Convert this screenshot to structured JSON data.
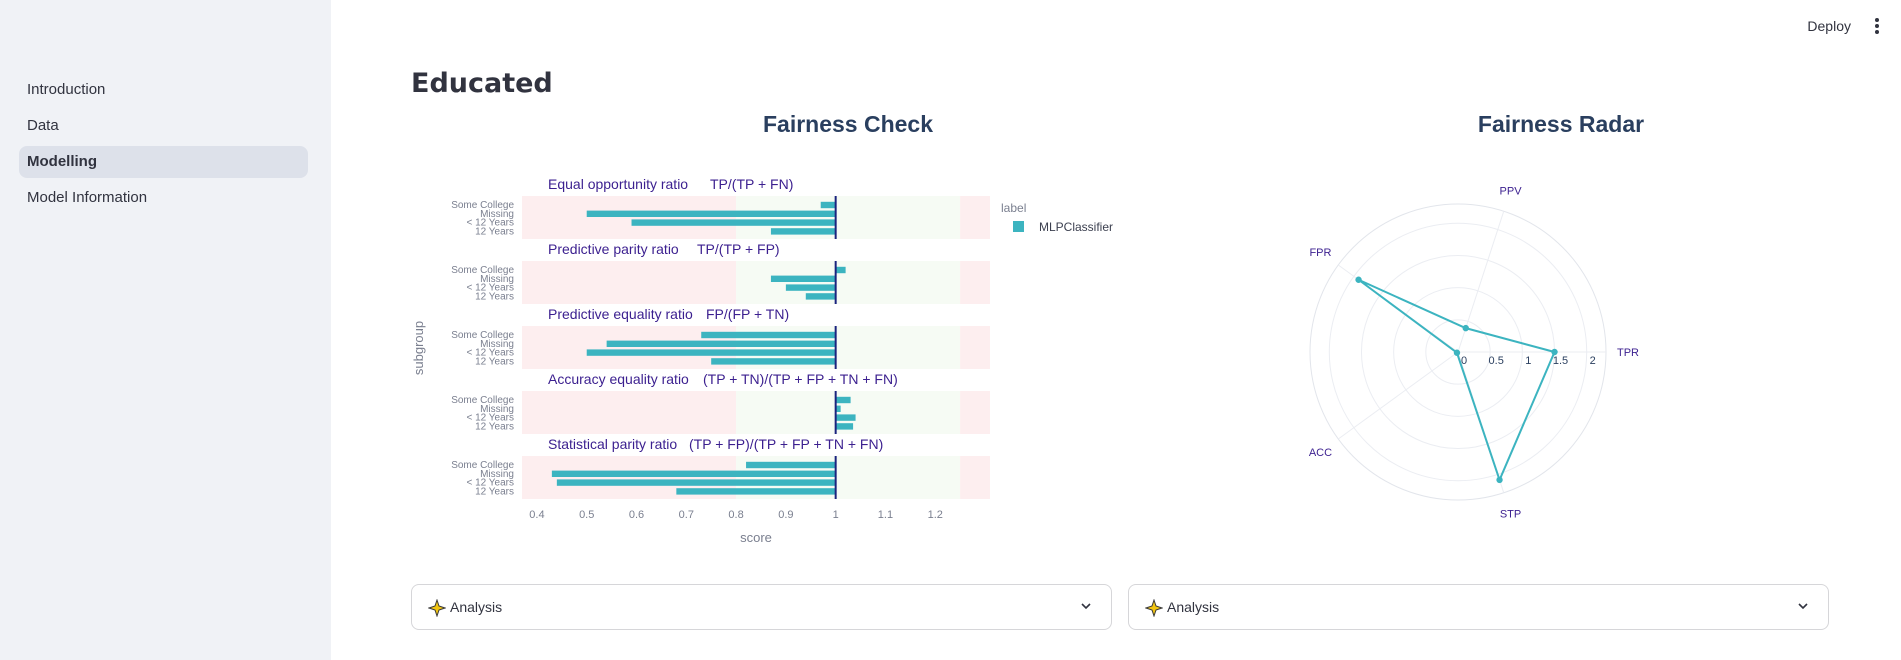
{
  "sidebar": {
    "items": [
      {
        "label": "Introduction",
        "active": false
      },
      {
        "label": "Data",
        "active": false
      },
      {
        "label": "Modelling",
        "active": true
      },
      {
        "label": "Model Information",
        "active": false
      }
    ]
  },
  "header": {
    "deploy_label": "Deploy",
    "menu_icon": "kebab-menu-icon"
  },
  "main": {
    "title": "Educated"
  },
  "expanders": [
    {
      "label": "Analysis",
      "icon": "sparkle-icon"
    },
    {
      "label": "Analysis",
      "icon": "sparkle-icon"
    }
  ],
  "chart_data": [
    {
      "type": "bar",
      "title": "Fairness Check",
      "xlabel": "score",
      "ylabel": "subgroup",
      "xlim": [
        0.37,
        1.31
      ],
      "xticks": [
        "0.4",
        "0.5",
        "0.6",
        "0.7",
        "0.8",
        "0.9",
        "1",
        "1.1",
        "1.2"
      ],
      "reference_line": 1,
      "fair_range": [
        0.8,
        1.25
      ],
      "legend": {
        "title": "label",
        "entries": [
          "MLPClassifier"
        ],
        "placement": "right"
      },
      "color": "#3cb4c0",
      "categories": [
        "Some College",
        "Missing",
        "< 12 Years",
        "12 Years"
      ],
      "panels": [
        {
          "title": "Equal opportunity ratio",
          "formula": "TP/(TP + FN)",
          "values": [
            0.97,
            0.5,
            0.59,
            0.87
          ]
        },
        {
          "title": "Predictive parity ratio",
          "formula": "TP/(TP + FP)",
          "values": [
            1.02,
            0.87,
            0.9,
            0.94
          ]
        },
        {
          "title": "Predictive equality ratio",
          "formula": "FP/(FP + TN)",
          "values": [
            0.73,
            0.54,
            0.5,
            0.75
          ]
        },
        {
          "title": "Accuracy equality ratio",
          "formula": "(TP + TN)/(TP + FP + TN + FN)",
          "values": [
            1.03,
            1.01,
            1.04,
            1.035
          ]
        },
        {
          "title": "Statistical parity ratio",
          "formula": "(TP + FP)/(TP + FP + TN + FN)",
          "values": [
            0.82,
            0.43,
            0.44,
            0.68
          ]
        }
      ]
    },
    {
      "type": "radar",
      "title": "Fairness Radar",
      "axes": [
        "TPR",
        "PPV",
        "FPR",
        "ACC",
        "STP"
      ],
      "radial_ticks": [
        "0",
        "0.5",
        "1",
        "1.5",
        "2"
      ],
      "radial_range": [
        0,
        2.3
      ],
      "series": [
        {
          "name": "MLPClassifier",
          "values": [
            1.5,
            0.39,
            1.91,
            0.02,
            2.09
          ]
        }
      ],
      "color": "#3cb4c0"
    }
  ]
}
